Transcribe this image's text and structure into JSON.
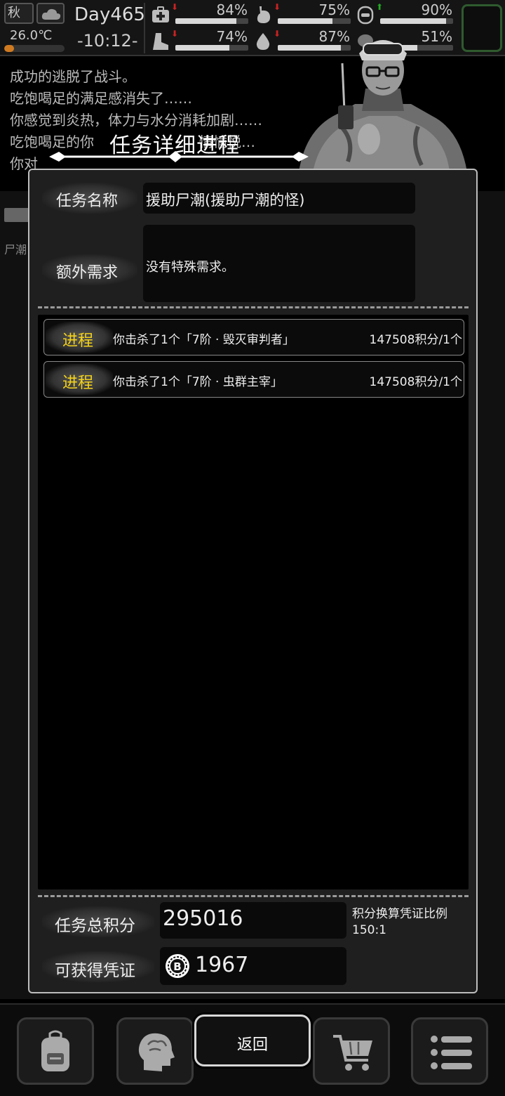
{
  "status": {
    "season": "秋",
    "temperature": "26.0℃",
    "temperature_level": 0.16,
    "day": "Day465",
    "time": "-10:12-",
    "stats": [
      {
        "name": "health",
        "icon": "medkit-icon",
        "trend": "down",
        "value": "84%",
        "level": 0.84
      },
      {
        "name": "hunger",
        "icon": "stomach-icon",
        "trend": "down",
        "value": "75%",
        "level": 0.75
      },
      {
        "name": "mood",
        "icon": "mood-icon",
        "trend": "up",
        "value": "90%",
        "level": 0.9
      },
      {
        "name": "stamina",
        "icon": "boot-icon",
        "trend": "down",
        "value": "74%",
        "level": 0.74
      },
      {
        "name": "thirst",
        "icon": "water-drop-icon",
        "trend": "down",
        "value": "87%",
        "level": 0.87
      },
      {
        "name": "spirit",
        "icon": "brain-icon",
        "trend": "none",
        "value": "51%",
        "level": 0.51
      }
    ]
  },
  "log": [
    "成功的逃脱了战斗。",
    "吃饱喝足的满足感消失了……",
    "你感觉到炎热，体力与水分消耗加剧……",
    "吃饱喝足的你",
    "你对"
  ],
  "log_fragment": "情愉悦…",
  "background_label": "尸潮",
  "dialog": {
    "title": "任务详细进程",
    "task_name_label": "任务名称",
    "task_name": "援助尸潮(援助尸潮的怪)",
    "extra_label": "额外需求",
    "extra_value": "没有特殊需求。",
    "entries": [
      {
        "tag": "进程",
        "desc": "你击杀了1个「7阶 · 毁灭审判者」",
        "score": "147508积分/1个"
      },
      {
        "tag": "进程",
        "desc": "你击杀了1个「7阶 · 虫群主宰」",
        "score": "147508积分/1个"
      }
    ],
    "total_label": "任务总积分",
    "total_value": "295016",
    "ratio_label": "积分换算凭证比例",
    "ratio_value": "150:1",
    "voucher_label": "可获得凭证",
    "voucher_value": "1967"
  },
  "bottom": {
    "return_label": "返回",
    "nav_icons": [
      "backpack-icon",
      "brain-icon",
      "cart-icon",
      "menu-icon"
    ]
  },
  "colors": {
    "accent_yellow": "#f5d31a",
    "trend_down": "#cc2222",
    "trend_up": "#22aa22"
  }
}
